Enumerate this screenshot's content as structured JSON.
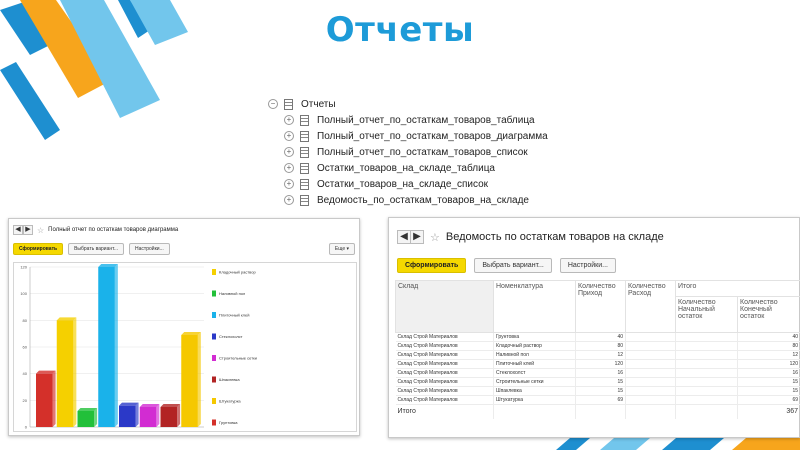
{
  "slide": {
    "title": "Отчеты"
  },
  "tree": {
    "root": "Отчеты",
    "items": [
      "Полный_отчет_по_остаткам_товаров_таблица",
      "Полный_отчет_по_остаткам_товаров_диаграмма",
      "Полный_отчет_по_остаткам_товаров_список",
      "Остатки_товаров_на_складе_таблица",
      "Остатки_товаров_на_складе_список",
      "Ведомость_по_остаткам_товаров_на_складе"
    ]
  },
  "window_chart": {
    "title": "Полный отчет по остаткам товаров диаграмма",
    "buttons": {
      "generate": "Сформировать",
      "variant": "Выбрать вариант...",
      "settings": "Настройки..."
    },
    "more": "Еще ▾"
  },
  "chart_data": {
    "type": "bar",
    "title": "",
    "xlabel": "",
    "ylabel": "",
    "ylim": [
      0,
      120
    ],
    "yticks": [
      0,
      20,
      40,
      60,
      80,
      100,
      120
    ],
    "grid": true,
    "legend_position": "right",
    "categories": [
      "Кладочный раствор",
      "Наливной пол",
      "Плиточный клей",
      "Стеклохолст",
      "Строительные сетки",
      "Шпаклевка",
      "Штукатурка",
      "Грунтовка"
    ],
    "values": [
      80,
      12,
      120,
      16,
      15,
      15,
      69,
      40
    ],
    "bar_order": [
      "Грунтовка",
      "Кладочный раствор",
      "Наливной пол",
      "Плиточный клей",
      "Стеклохолст",
      "Строительные сетки",
      "Шпаклевка",
      "Штукатурка"
    ],
    "colors": {
      "Грунтовка": "#d4302a",
      "Кладочный раствор": "#f5d000",
      "Наливной пол": "#22c03a",
      "Плиточный клей": "#1ab2ea",
      "Стеклохолст": "#2b39c8",
      "Строительные сетки": "#d22cd2",
      "Шпаклевка": "#b22424",
      "Штукатурка": "#f5c800"
    }
  },
  "window_report": {
    "title": "Ведомость по остаткам товаров на складе",
    "buttons": {
      "generate": "Сформировать",
      "variant": "Выбрать вариант...",
      "settings": "Настройки..."
    },
    "headers": {
      "sklad": "Склад",
      "nomenclature": "Номенклатура",
      "income": "Количество Приход",
      "expense": "Количество Расход",
      "total": "Итого",
      "start": "Количество Начальный остаток",
      "end": "Количество Конечный остаток"
    },
    "rows": [
      {
        "sklad": "Склад Строй Материалов",
        "item": "Грунтовка",
        "income": "40",
        "end": "40"
      },
      {
        "sklad": "Склад Строй Материалов",
        "item": "Кладочный раствор",
        "income": "80",
        "end": "80"
      },
      {
        "sklad": "Склад Строй Материалов",
        "item": "Наливной пол",
        "income": "12",
        "end": "12"
      },
      {
        "sklad": "Склад Строй Материалов",
        "item": "Плиточный клей",
        "income": "120",
        "end": "120"
      },
      {
        "sklad": "Склад Строй Материалов",
        "item": "Стеклохолст",
        "income": "16",
        "end": "16"
      },
      {
        "sklad": "Склад Строй Материалов",
        "item": "Строительные сетки",
        "income": "15",
        "end": "15"
      },
      {
        "sklad": "Склад Строй Материалов",
        "item": "Шпаклевка",
        "income": "15",
        "end": "15"
      },
      {
        "sklad": "Склад Строй Материалов",
        "item": "Штукатурка",
        "income": "69",
        "end": "69"
      }
    ],
    "total_label": "Итого",
    "total_value": "367"
  }
}
